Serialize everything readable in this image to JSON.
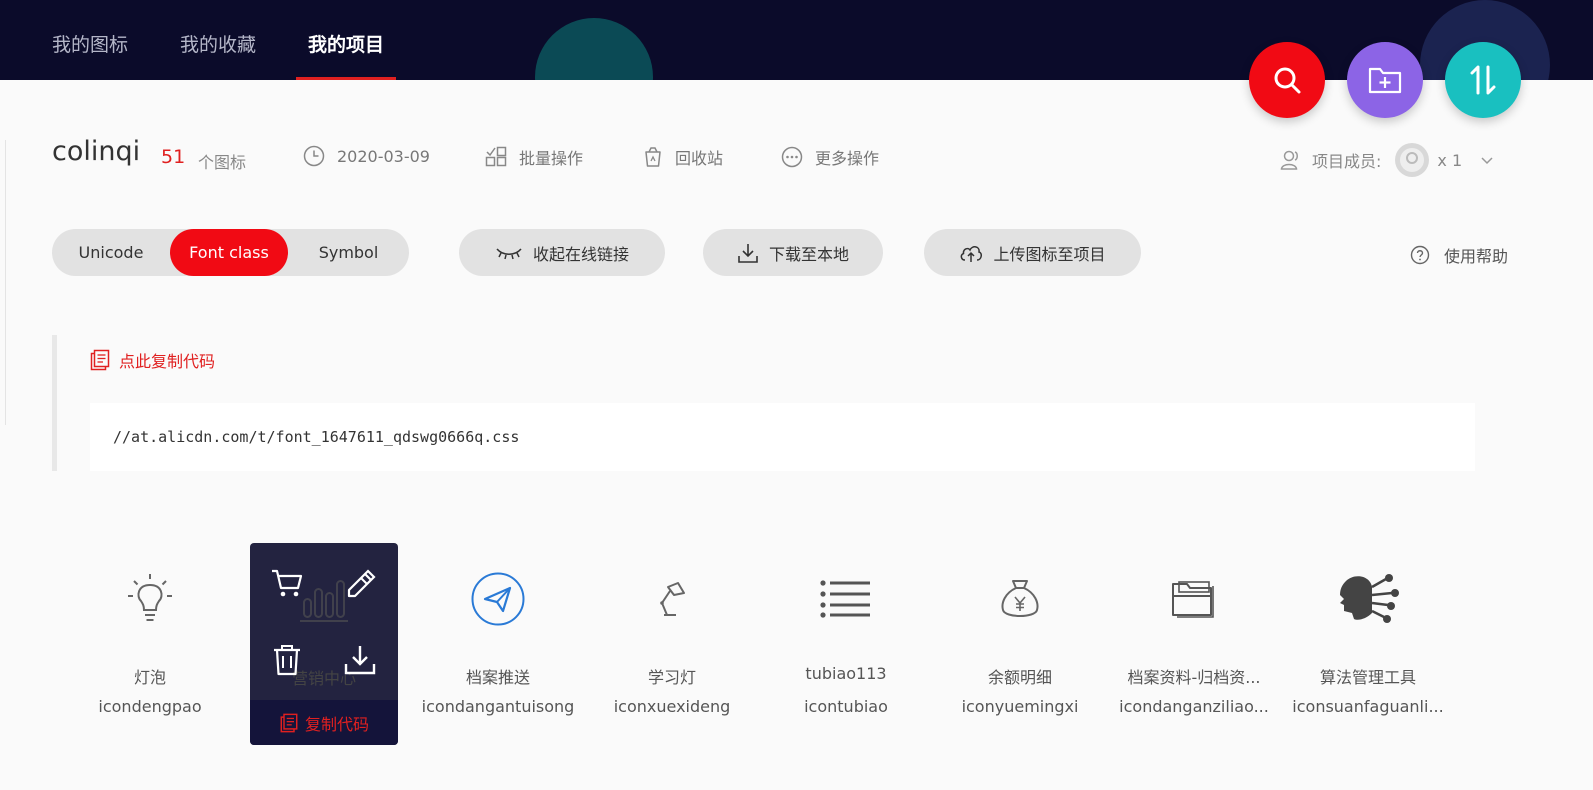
{
  "nav": {
    "tabs": [
      "我的图标",
      "我的收藏",
      "我的项目"
    ],
    "active_index": 2
  },
  "fabs": {
    "search": "search-icon",
    "add_folder": "folder-add-icon",
    "sort": "sort-icon"
  },
  "project": {
    "name": "colinqi",
    "count": "51",
    "count_unit": "个图标",
    "date": "2020-03-09",
    "batch": "批量操作",
    "recycle": "回收站",
    "more": "更多操作",
    "members_label": "项目成员:",
    "members_count": "x 1"
  },
  "toolbar": {
    "segments": [
      "Unicode",
      "Font class",
      "Symbol"
    ],
    "active_segment": 1,
    "collapse_link": "收起在线链接",
    "download": "下载至本地",
    "upload": "上传图标至项目",
    "help": "使用帮助"
  },
  "code": {
    "copy_label": "点此复制代码",
    "url": "//at.alicdn.com/t/font_1647611_qdswg0666q.css"
  },
  "icons": [
    {
      "name": "灯泡",
      "code": "icondengpao",
      "glyph": "lightbulb-icon"
    },
    {
      "name": "营销中心",
      "code": "",
      "glyph": "bar-chart-icon"
    },
    {
      "name": "档案推送",
      "code": "icondangantuisong",
      "glyph": "send-icon"
    },
    {
      "name": "学习灯",
      "code": "iconxuexideng",
      "glyph": "desk-lamp-icon"
    },
    {
      "name": "tubiao113",
      "code": "icontubiao",
      "glyph": "list-icon"
    },
    {
      "name": "余额明细",
      "code": "iconyuemingxi",
      "glyph": "money-bag-icon"
    },
    {
      "name": "档案资料-归档资...",
      "code": "icondanganziliao...",
      "glyph": "folder-files-icon"
    },
    {
      "name": "算法管理工具",
      "code": "iconsuanfaguanli...",
      "glyph": "ai-head-icon"
    }
  ],
  "hover_card": {
    "copy_label": "复制代码"
  }
}
